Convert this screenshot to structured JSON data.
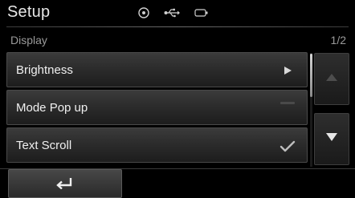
{
  "header": {
    "title": "Setup",
    "status_icons": [
      "disc-icon",
      "usb-icon",
      "battery-icon"
    ]
  },
  "subheader": {
    "label": "Display",
    "page_indicator": "1/2"
  },
  "list": {
    "items": [
      {
        "label": "Brightness",
        "marker": "play-arrow-icon"
      },
      {
        "label": "Mode Pop up",
        "marker": "dash-indicator-icon"
      },
      {
        "label": "Text Scroll",
        "marker": "checkmark-icon"
      }
    ]
  },
  "navigation": {
    "scroll_up": "scroll-up-icon",
    "scroll_down": "scroll-down-icon",
    "back": "back-arrow-icon"
  },
  "colors": {
    "background": "#000000",
    "item_text": "#f0f0f0",
    "muted_text": "#9a9a9a"
  }
}
